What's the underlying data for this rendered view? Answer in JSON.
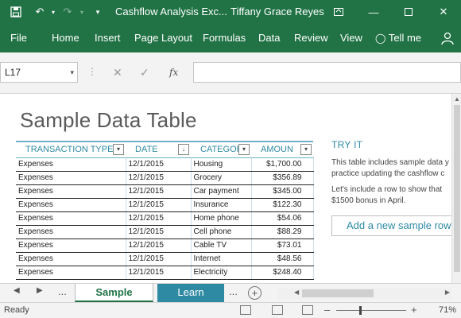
{
  "titlebar": {
    "title": "Cashflow Analysis Exc...",
    "user": "Tiffany Grace Reyes"
  },
  "ribbon": {
    "tabs": [
      "File",
      "Home",
      "Insert",
      "Page Layout",
      "Formulas",
      "Data",
      "Review",
      "View"
    ],
    "tell_me": "Tell me"
  },
  "formula_bar": {
    "cell_ref": "L17",
    "fx": "fx",
    "content": ""
  },
  "sheet": {
    "title": "Sample Data Table",
    "columns": [
      "TRANSACTION TYPE",
      "DATE",
      "CATEGORY",
      "AMOUN"
    ],
    "rows": [
      [
        "Expenses",
        "12/1/2015",
        "Housing",
        "$1,700.00"
      ],
      [
        "Expenses",
        "12/1/2015",
        "Grocery",
        "$356.89"
      ],
      [
        "Expenses",
        "12/1/2015",
        "Car payment",
        "$345.00"
      ],
      [
        "Expenses",
        "12/1/2015",
        "Insurance",
        "$122.30"
      ],
      [
        "Expenses",
        "12/1/2015",
        "Home phone",
        "$54.06"
      ],
      [
        "Expenses",
        "12/1/2015",
        "Cell phone",
        "$88.29"
      ],
      [
        "Expenses",
        "12/1/2015",
        "Cable TV",
        "$73.01"
      ],
      [
        "Expenses",
        "12/1/2015",
        "Internet",
        "$48.56"
      ],
      [
        "Expenses",
        "12/1/2015",
        "Electricity",
        "$248.40"
      ]
    ],
    "try_it": {
      "heading": "TRY IT",
      "line1": "This table includes sample data y",
      "line2": "practice updating the cashflow c",
      "line3": "Let's include a row to show that",
      "line4": "$1500 bonus in April.",
      "button": "Add a new sample row"
    }
  },
  "sheet_tabs": {
    "ellipsis": "...",
    "active": "Sample Data",
    "other": "Learn More"
  },
  "status": {
    "ready": "Ready",
    "zoom": "71%",
    "zoom_level": 0.71
  },
  "colors": {
    "accent": "#217346",
    "table_accent": "#2e8aa3"
  }
}
